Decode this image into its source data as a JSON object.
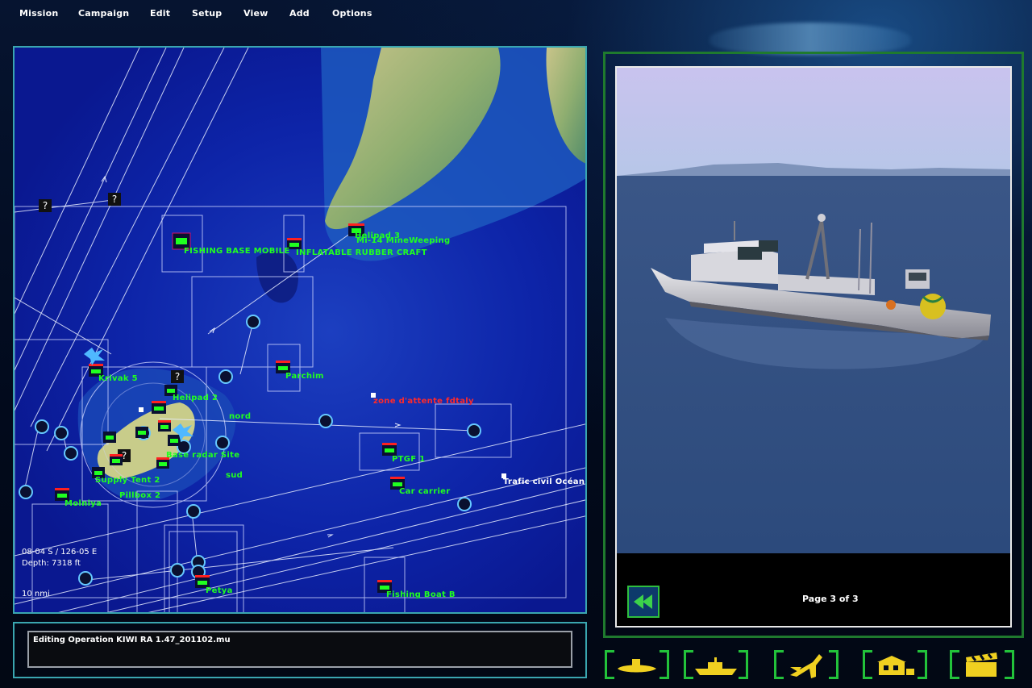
{
  "menu": {
    "items": [
      "Mission",
      "Campaign",
      "Edit",
      "Setup",
      "View",
      "Add",
      "Options"
    ]
  },
  "map": {
    "unit_labels": [
      {
        "text": "Helipad 3",
        "color": "green"
      },
      {
        "text": "Mi-14 MineWeeping",
        "color": "green"
      },
      {
        "text": "FISHING BASE MOBILE",
        "color": "green"
      },
      {
        "text": "INFLATABLE RUBBER CRAFT",
        "color": "green"
      },
      {
        "text": "Parchim",
        "color": "green"
      },
      {
        "text": "Krivak 5",
        "color": "green"
      },
      {
        "text": "Helipad 2",
        "color": "green"
      },
      {
        "text": "zone d'attente fdtaly",
        "color": "red"
      },
      {
        "text": "PTGF 1",
        "color": "green"
      },
      {
        "text": "Car carrier",
        "color": "green"
      },
      {
        "text": "Trafic civil Océan",
        "color": "white"
      },
      {
        "text": "Supply Tent 2",
        "color": "green"
      },
      {
        "text": "Pillbox 2",
        "color": "green"
      },
      {
        "text": "Molniya",
        "color": "green"
      },
      {
        "text": "Petya",
        "color": "green"
      },
      {
        "text": "Fishing Boat B",
        "color": "green"
      },
      {
        "text": "Base radar Site",
        "color": "green"
      },
      {
        "text": "nord",
        "color": "green"
      },
      {
        "text": "sud",
        "color": "green"
      }
    ],
    "coordinates": "08-04 S / 126-05 E",
    "depth": "Depth: 7318 ft",
    "scale": "10 nmi"
  },
  "preview": {
    "page_label": "Page 3 of 3",
    "back_icon": "rewind-icon"
  },
  "status": {
    "text": "Editing Operation KIWI RA 1.47_201102.mu"
  },
  "tools": [
    "submarine-icon",
    "surface-ship-icon",
    "aircraft-icon",
    "land-unit-icon",
    "clapperboard-icon"
  ],
  "colors": {
    "unit_label": "#20ff20",
    "hostile": "#ff2a2a",
    "panel_border": "#3aa6b0",
    "tool_bracket": "#22c23a"
  }
}
